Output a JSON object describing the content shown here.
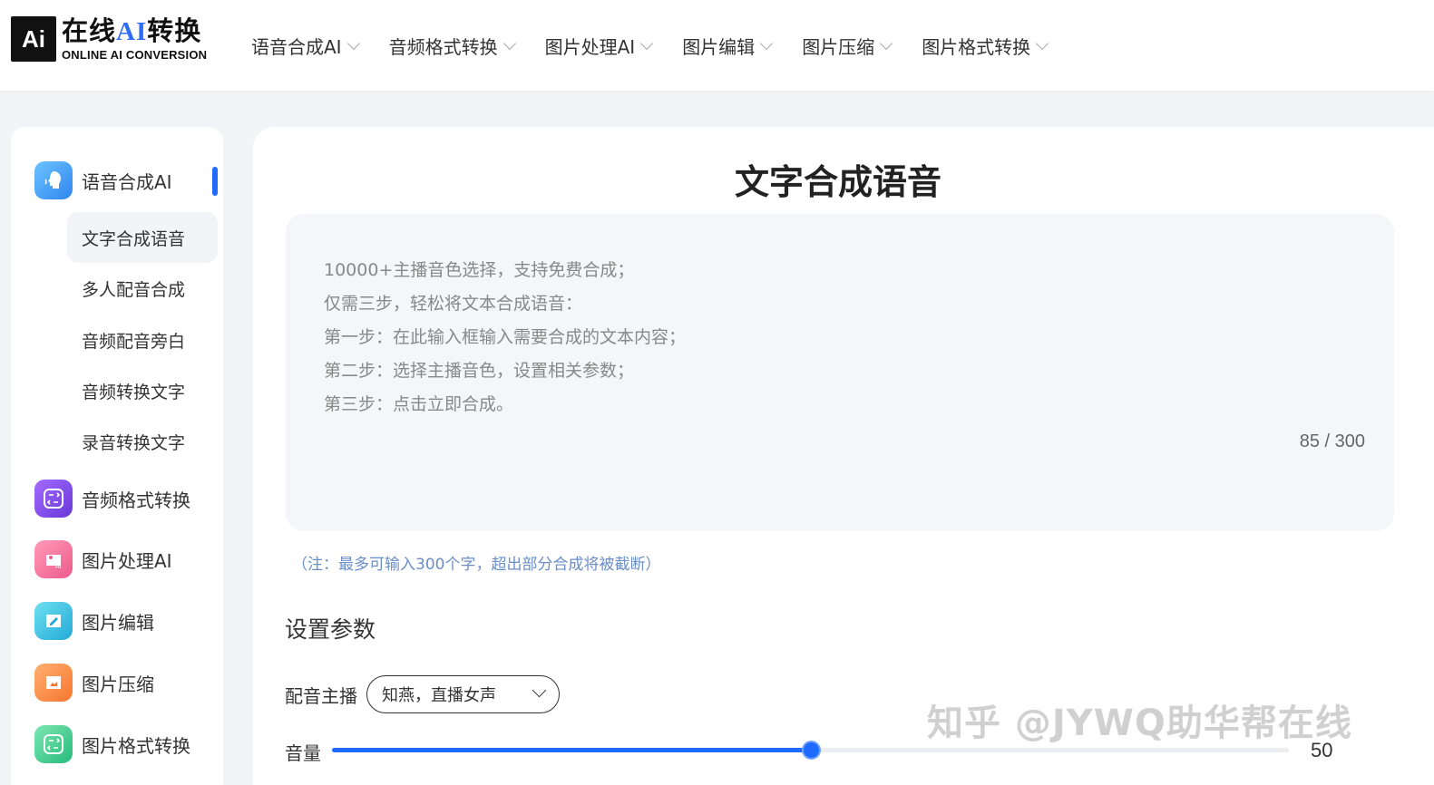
{
  "logo": {
    "mark": "Ai",
    "title_prefix": "在线",
    "title_ai": "AI",
    "title_suffix": "转换",
    "subtitle": "ONLINE AI CONVERSION"
  },
  "nav": [
    {
      "label": "语音合成AI"
    },
    {
      "label": "音频格式转换"
    },
    {
      "label": "图片处理AI"
    },
    {
      "label": "图片编辑"
    },
    {
      "label": "图片压缩"
    },
    {
      "label": "图片格式转换"
    }
  ],
  "sidebar": {
    "categories": [
      {
        "label": "语音合成AI",
        "icon": "microphone-head-icon",
        "color": "#4aa3f5"
      },
      {
        "label": "音频格式转换",
        "icon": "audio-convert-icon",
        "color": "#8a52e8"
      },
      {
        "label": "图片处理AI",
        "icon": "image-ai-icon",
        "color": "#f06b9a"
      },
      {
        "label": "图片编辑",
        "icon": "image-edit-icon",
        "color": "#3cc6e0"
      },
      {
        "label": "图片压缩",
        "icon": "image-compress-icon",
        "color": "#fb8b4a"
      },
      {
        "label": "图片格式转换",
        "icon": "image-convert-icon",
        "color": "#3fce8f"
      }
    ],
    "sub_items": [
      {
        "label": "文字合成语音"
      },
      {
        "label": "多人配音合成"
      },
      {
        "label": "音频配音旁白"
      },
      {
        "label": "音频转换文字"
      },
      {
        "label": "录音转换文字"
      }
    ]
  },
  "main": {
    "title": "文字合成语音",
    "placeholder": "10000+主播音色选择，支持免费合成；\n仅需三步，轻松将文本合成语音：\n第一步：在此输入框输入需要合成的文本内容；\n第二步：选择主播音色，设置相关参数；\n第三步：点击立即合成。",
    "counter": "85 / 300",
    "note": "（注：最多可输入300个字，超出部分合成将被截断）",
    "section_title": "设置参数",
    "voice_label": "配音主播",
    "voice_value": "知燕，直播女声",
    "volume_label": "音量",
    "volume_value": "50",
    "volume_fraction": 0.5
  },
  "watermark": "知乎 @JYWQ助华帮在线",
  "colors": {
    "accent": "#1f6bff",
    "note": "#6b8ec7"
  }
}
